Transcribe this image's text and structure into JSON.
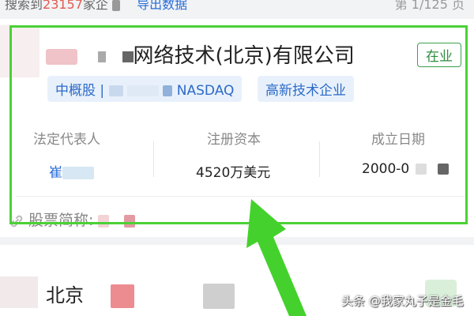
{
  "topbar": {
    "search_prefix": "搜索到",
    "search_count": "23157",
    "search_suffix": "家企",
    "export_label": "导出数据",
    "page_indicator": "第 1/125 页"
  },
  "company": {
    "name_visible": "网络技术(北京)有限公司",
    "status": "在业",
    "tags": [
      "中概股 | ",
      "NASDAQ",
      "高新技术企业"
    ],
    "legal_rep_label": "法定代表人",
    "legal_rep_value": "崔",
    "capital_label": "注册资本",
    "capital_value": "4520万美元",
    "date_label": "成立日期",
    "date_value": "2000-0",
    "stock_label": "股票简称:"
  },
  "next_company": {
    "name_visible": "北京"
  },
  "watermark": "头条 @我家丸子是金毛",
  "colors": {
    "highlight_green": "#4cd137",
    "status_green": "#2f8c3e",
    "link_blue": "#2a6dd8",
    "tag_bg": "#e8f1fb",
    "count_red": "#e25b4f"
  }
}
